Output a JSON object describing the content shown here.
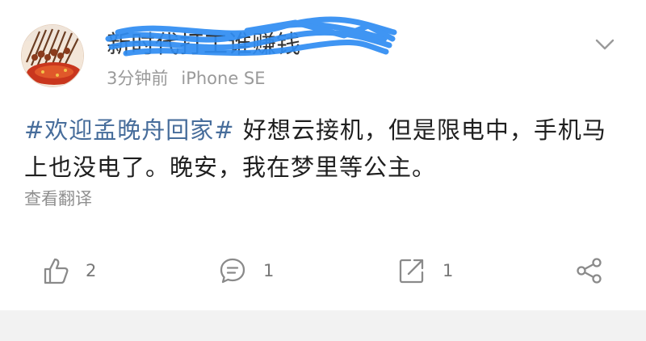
{
  "post": {
    "username": "新时代打工谁赚钱",
    "time": "3分钟前",
    "device": "iPhone SE",
    "topic": "#欢迎孟晚舟回家#",
    "text": " 好想云接机，但是限电中，手机马上也没电了。晚安，我在梦里等公主。",
    "translate_label": "查看翻译"
  },
  "actions": {
    "likes": "2",
    "comments": "1",
    "reposts": "1"
  },
  "icons": {
    "avatar": "avatar-photo",
    "more": "chevron-down-icon",
    "like": "thumbs-up-icon",
    "comment": "comment-bubble-icon",
    "repost": "repost-icon",
    "share": "share-icon"
  },
  "colors": {
    "topic": "#476d9b",
    "scribble": "#2f8df2",
    "meta": "#9a9a9a"
  }
}
